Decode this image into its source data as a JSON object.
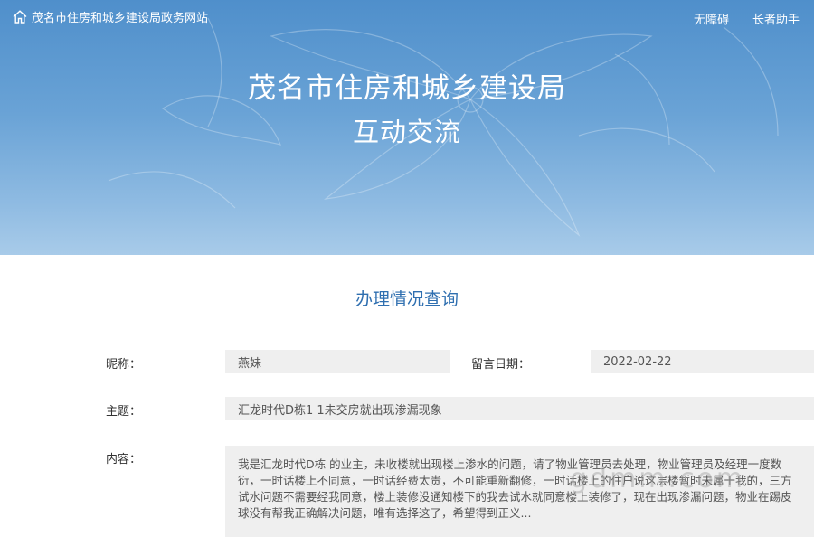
{
  "header": {
    "site_name": "茂名市住房和城乡建设局政务网站",
    "home_icon": "home-icon",
    "links": [
      {
        "label": "无障碍"
      },
      {
        "label": "长者助手"
      }
    ]
  },
  "hero": {
    "title": "茂名市住房和城乡建设局",
    "subtitle": "互动交流"
  },
  "section": {
    "title": "办理情况查询"
  },
  "form": {
    "nickname_label": "昵称：",
    "nickname_value": "燕妹",
    "date_label": "留言日期：",
    "date_value": "2022-02-22",
    "subject_label": "主题：",
    "subject_value": "汇龙时代D栋1  1未交房就出现渗漏现象",
    "content_label": "内容：",
    "content_value": "我是汇龙时代D栋     的业主，未收楼就出现楼上渗水的问题，请了物业管理员去处理，物业管理员及经理一度数衍，一时话楼上不同意，一时话经费太贵，不可能重新翻修，一时话楼上的住户说这层楼暂时未属于我的，三方试水问题不需要经我同意，楼上装修没通知楼下的我去试水就同意楼上装修了，现在出现渗漏问题，物业在踢皮球没有帮我正确解决问题，唯有选择这了，希望得到正义..."
  },
  "watermark": "gdmm.com"
}
